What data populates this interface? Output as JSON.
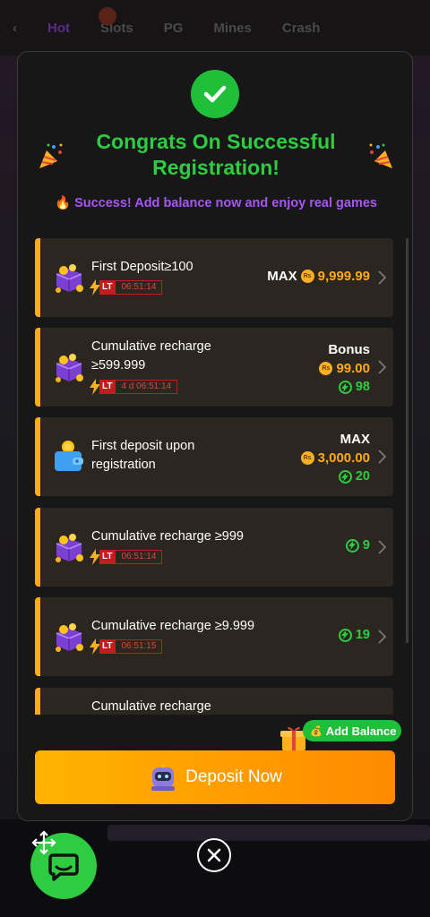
{
  "background": {
    "tabs": [
      "Hot",
      "Slots",
      "PG",
      "Mines",
      "Crash"
    ]
  },
  "modal": {
    "title": "Congrats On Successful Registration!",
    "subtitle": "Success! Add balance now and enjoy real games",
    "items": [
      {
        "name": "First Deposit≥100",
        "lt_label": "LT",
        "timer": "06:51:14",
        "max_label": "MAX",
        "amount": "9,999.99"
      },
      {
        "name": "Cumulative recharge ≥599.999",
        "lt_label": "LT",
        "timer": "4 d 06:51:14",
        "top_label": "Bonus",
        "amount": "99.00",
        "energy": "98"
      },
      {
        "name": "First deposit upon registration",
        "top_label": "MAX",
        "amount": "3,000.00",
        "energy": "20"
      },
      {
        "name": "Cumulative recharge ≥999",
        "lt_label": "LT",
        "timer": "06:51:14",
        "energy": "9"
      },
      {
        "name": "Cumulative recharge ≥9.999",
        "lt_label": "LT",
        "timer": "06:51:15",
        "energy": "19"
      },
      {
        "name": "Cumulative recharge"
      }
    ],
    "add_balance_label": "Add Balance",
    "deposit_button_label": "Deposit Now",
    "coin_symbol": "Rs"
  },
  "colors": {
    "accent_orange": "#ffab14",
    "success_green": "#2ecc40",
    "subtitle_purple": "#a855f7",
    "timer_red": "#c11d1d"
  }
}
